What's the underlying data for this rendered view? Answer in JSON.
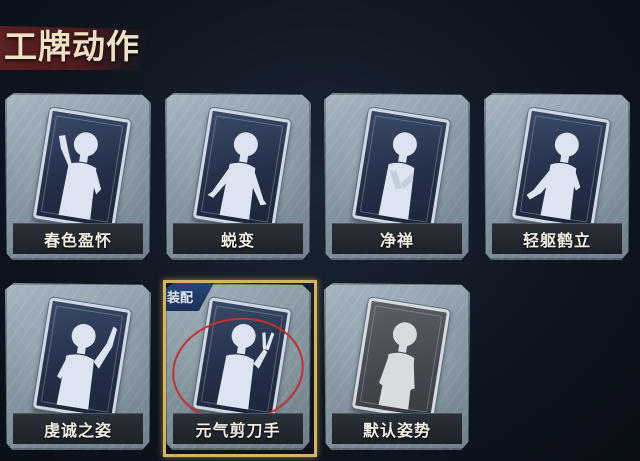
{
  "page": {
    "title": "工牌动作"
  },
  "cards": [
    {
      "label": "春色盈怀",
      "pose": "hand-up",
      "style": "dark-blue",
      "equipped": false
    },
    {
      "label": "蜕变",
      "pose": "arms-out",
      "style": "dark-blue",
      "equipped": false
    },
    {
      "label": "净禅",
      "pose": "hands-center",
      "style": "dark-blue",
      "equipped": false
    },
    {
      "label": "轻躯鹤立",
      "pose": "arm-raised",
      "style": "dark-blue",
      "equipped": false
    },
    {
      "label": "虔诚之姿",
      "pose": "hand-up-right",
      "style": "dark-blue",
      "equipped": false
    },
    {
      "label": "元气剪刀手",
      "pose": "peace-sign",
      "style": "dark-blue",
      "equipped": true,
      "badge": "装配"
    },
    {
      "label": "默认姿势",
      "pose": "default",
      "style": "grey",
      "equipped": false
    }
  ],
  "colors": {
    "equip_frame": "#d6b35c",
    "equip_badge": "#27467a",
    "highlight_circle": "#c52f2f",
    "title_ribbon": "#5a2022"
  }
}
